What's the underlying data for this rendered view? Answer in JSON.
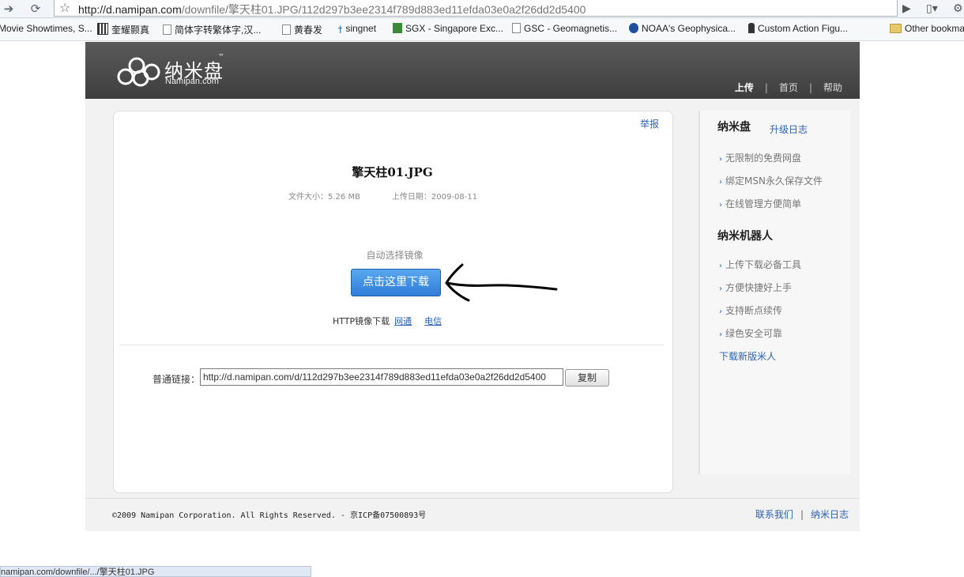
{
  "browser": {
    "url_domain": "http://d.namipan.com",
    "url_path": "/downfile/擎天柱01.JPG/112d297b3ee2314f789d883ed11efda03e0a2f26dd2d5400",
    "bookmarks": [
      {
        "label": "Movie Showtimes, S...",
        "icon": "page-icon"
      },
      {
        "label": "奎耀颢真",
        "icon": "grid-icon"
      },
      {
        "label": "简体字转繁体字,汉...",
        "icon": "page-icon"
      },
      {
        "label": "黄春发",
        "icon": "page-icon"
      },
      {
        "label": "singnet",
        "icon": "dagger-icon"
      },
      {
        "label": "SGX - Singapore Exc...",
        "icon": "green-icon"
      },
      {
        "label": "GSC - Geomagnetis...",
        "icon": "page-icon"
      },
      {
        "label": "NOAA's Geophysica...",
        "icon": "noaa-icon"
      },
      {
        "label": "Custom Action Figu...",
        "icon": "figure-icon"
      }
    ],
    "other_bookmarks": "Other bookmarks",
    "status_text": "namipan.com/downfile/.../擎天柱01.JPG"
  },
  "header": {
    "logo_cn": "纳米盘",
    "logo_tm": "™",
    "logo_en": "Namipan.com",
    "nav": [
      "上传",
      "首页",
      "帮助"
    ]
  },
  "file": {
    "report": "举报",
    "name": "擎天柱01.JPG",
    "size_label": "文件大小：5.26 MB",
    "date_label": "上传日期：2009-08-11",
    "auto_mirror": "自动选择镜像",
    "download_button": "点击这里下载",
    "http_mirror_label": "HTTP镜像下载",
    "mirror_1": "网通",
    "mirror_2": "电信",
    "link_label": "普通链接：",
    "link_value": "http://d.namipan.com/d/112d297b3ee2314f789d883ed11efda03e0a2f26dd2d5400",
    "copy_button": "复制"
  },
  "sidebar": {
    "title_1": "纳米盘",
    "upgrade_log": "升级日志",
    "features_1": [
      "无限制的免费网盘",
      "绑定MSN永久保存文件",
      "在线管理方便简单"
    ],
    "title_2": "纳米机器人",
    "features_2": [
      "上传下载必备工具",
      "方便快捷好上手",
      "支持断点续传",
      "绿色安全可靠"
    ],
    "download_robot": "下载新版米人"
  },
  "footer": {
    "copyright": "©2009 Namipan Corporation. All Rights Reserved. - 京ICP备07500893号",
    "contact": "联系我们",
    "blog": "纳米日志"
  }
}
